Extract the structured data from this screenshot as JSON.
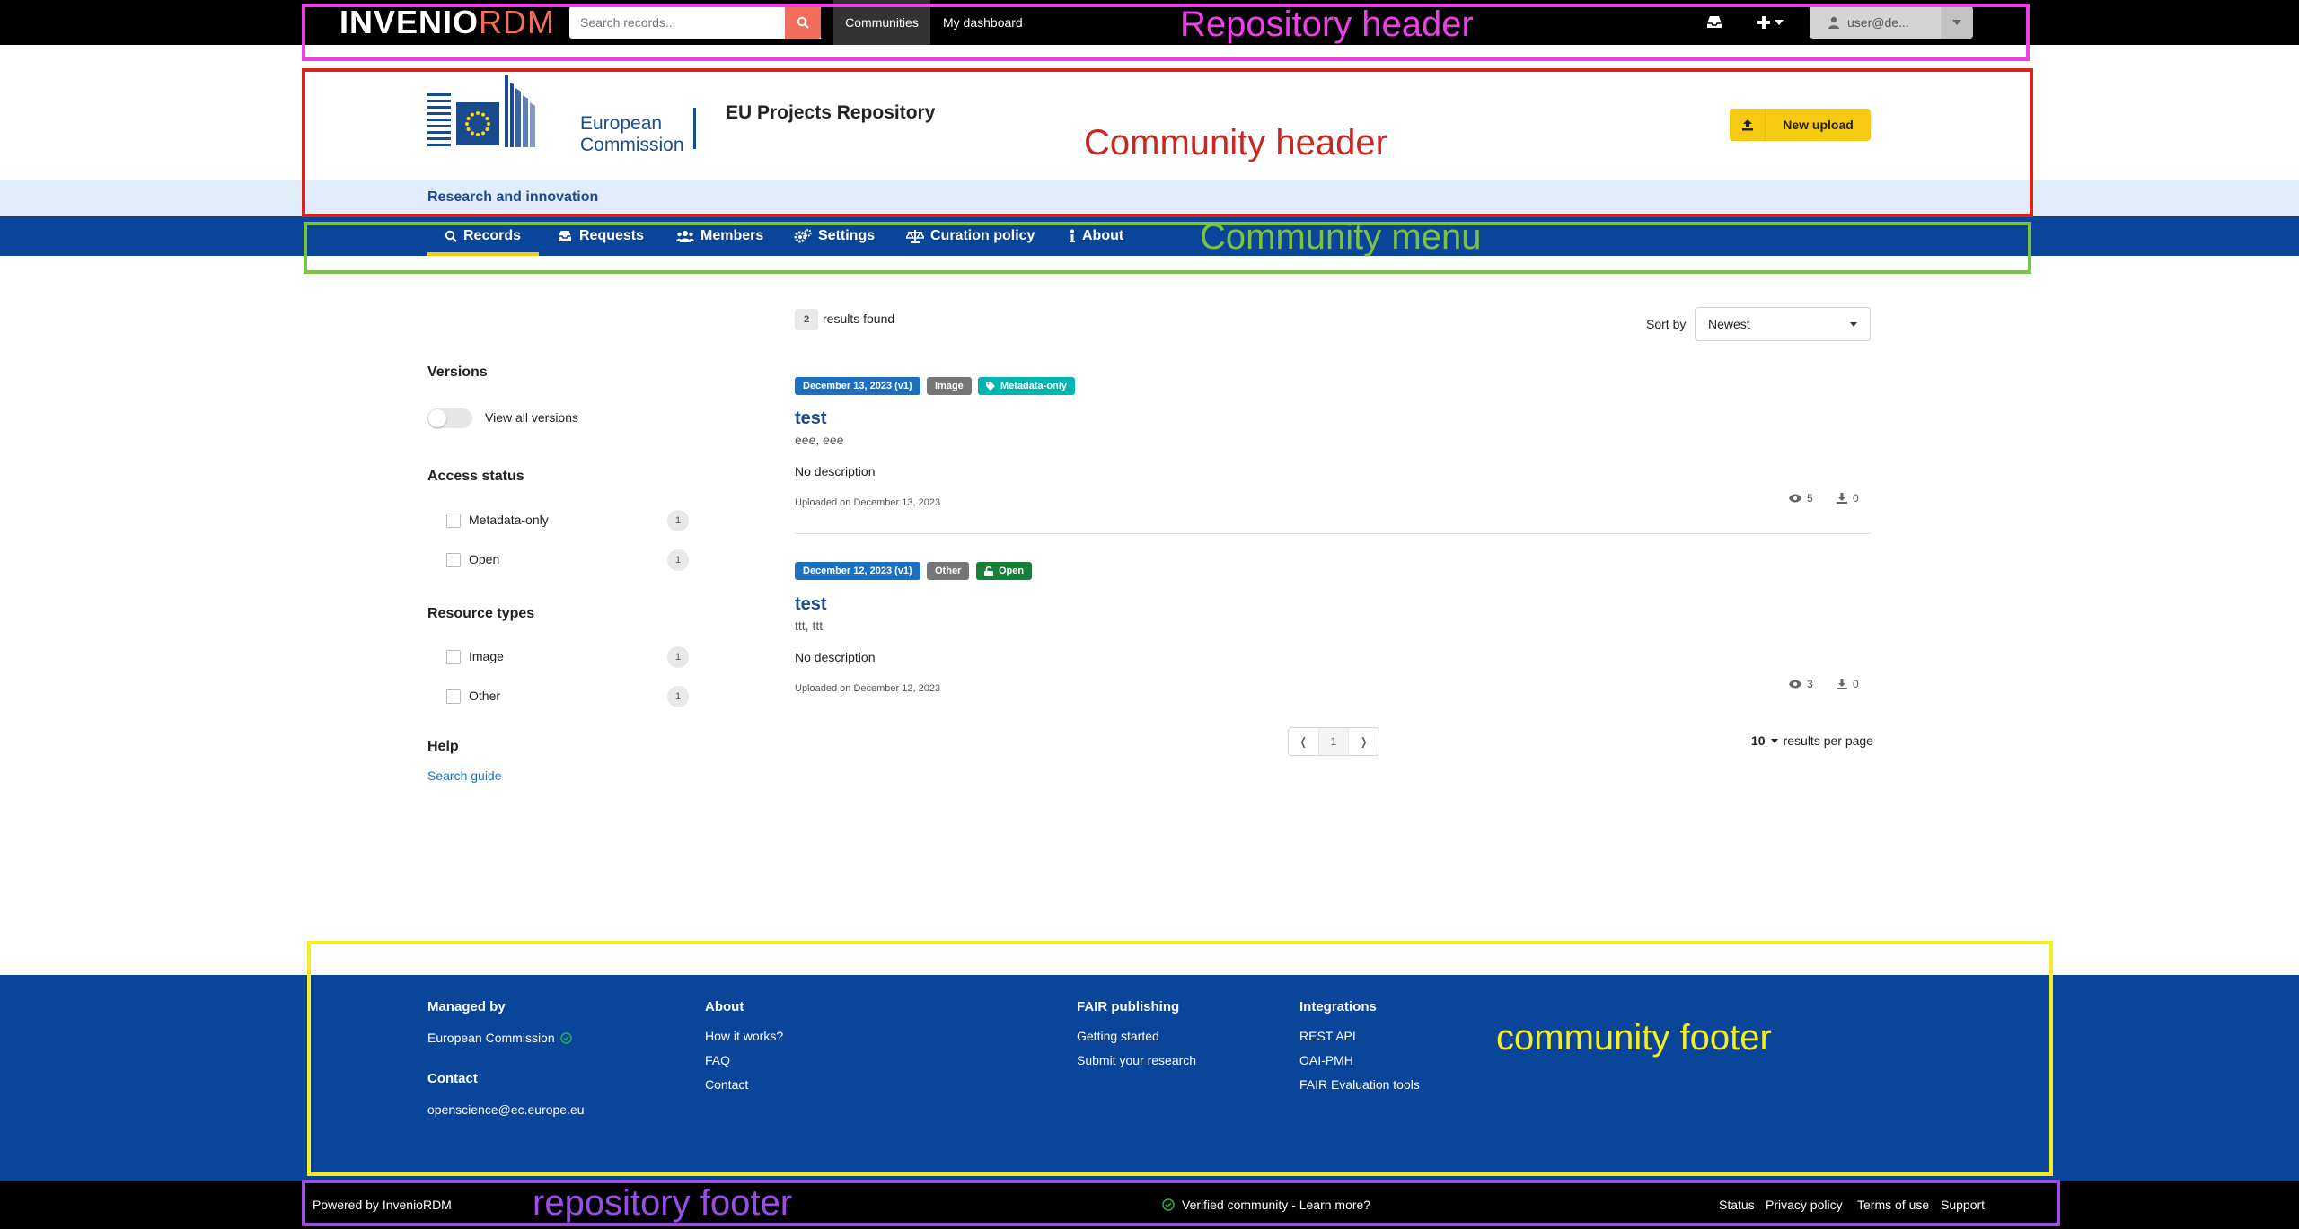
{
  "header": {
    "logo_main": "INVENIO",
    "logo_accent": "RDM",
    "search_placeholder": "Search records...",
    "nav_communities": "Communities",
    "nav_dashboard": "My dashboard",
    "user_label": "user@de..."
  },
  "community": {
    "logo_line1": "European",
    "logo_line2": "Commission",
    "title": "EU Projects Repository",
    "subtitle": "Research and innovation",
    "new_upload_label": "New upload"
  },
  "menu": {
    "items": [
      {
        "label": "Records",
        "icon": "search-icon",
        "active": true
      },
      {
        "label": "Requests",
        "icon": "inbox-icon"
      },
      {
        "label": "Members",
        "icon": "users-icon"
      },
      {
        "label": "Settings",
        "icon": "cogs-icon"
      },
      {
        "label": "Curation policy",
        "icon": "balance-scale-icon"
      },
      {
        "label": "About",
        "icon": "info-icon"
      }
    ]
  },
  "sidebar": {
    "versions_title": "Versions",
    "versions_toggle_label": "View all versions",
    "access_title": "Access status",
    "access_items": [
      {
        "label": "Metadata-only",
        "count": "1"
      },
      {
        "label": "Open",
        "count": "1"
      }
    ],
    "resource_title": "Resource types",
    "resource_items": [
      {
        "label": "Image",
        "count": "1"
      },
      {
        "label": "Other",
        "count": "1"
      }
    ],
    "help_title": "Help",
    "help_link": "Search guide"
  },
  "results": {
    "count": "2",
    "found_label": "results found",
    "sort_label": "Sort by",
    "sort_value": "Newest",
    "records": [
      {
        "date_badge": "December 13, 2023 (v1)",
        "type_badge": "Image",
        "access_badge": "Metadata-only",
        "title": "test",
        "authors": "eee, eee",
        "description": "No description",
        "uploaded": "Uploaded on December 13, 2023",
        "views": "5",
        "downloads": "0"
      },
      {
        "date_badge": "December 12, 2023 (v1)",
        "type_badge": "Other",
        "access_badge": "Open",
        "title": "test",
        "authors": "ttt, ttt",
        "description": "No description",
        "uploaded": "Uploaded on December 12, 2023",
        "views": "3",
        "downloads": "0"
      }
    ],
    "pager": {
      "prev": "❬",
      "page": "1",
      "next": "❭"
    },
    "per_page_value": "10",
    "per_page_label": "results per page"
  },
  "community_footer": {
    "managed_title": "Managed by",
    "managed_value": "European Commission",
    "contact_title": "Contact",
    "contact_value": "openscience@ec.europe.eu",
    "about_title": "About",
    "about_links": [
      "How it works?",
      "FAQ",
      "Contact"
    ],
    "fair_title": "FAIR publishing",
    "fair_links": [
      "Getting started",
      "Submit your research"
    ],
    "integrations_title": "Integrations",
    "integrations_links": [
      "REST API",
      "OAI-PMH",
      "FAIR Evaluation tools"
    ]
  },
  "repo_footer": {
    "powered": "Powered by InvenioRDM",
    "verified": "Verified community - Learn more?",
    "links": [
      "Status",
      "Privacy policy",
      "Terms of use",
      "Support"
    ]
  },
  "annotations": {
    "repository_header": "Repository header",
    "community_header": "Community header",
    "community_menu": "Community menu",
    "community_footer": "community footer",
    "repository_footer": "repository footer"
  },
  "colors": {
    "brand_blue": "#0a4599",
    "accent_yellow": "#f6c913",
    "logo_coral": "#f26f5d",
    "ann_magenta": "#ee3fe9",
    "ann_red": "#d9231f",
    "ann_green": "#7cc242",
    "ann_yellow": "#f4ee25",
    "ann_purple": "#9a4ee6"
  }
}
